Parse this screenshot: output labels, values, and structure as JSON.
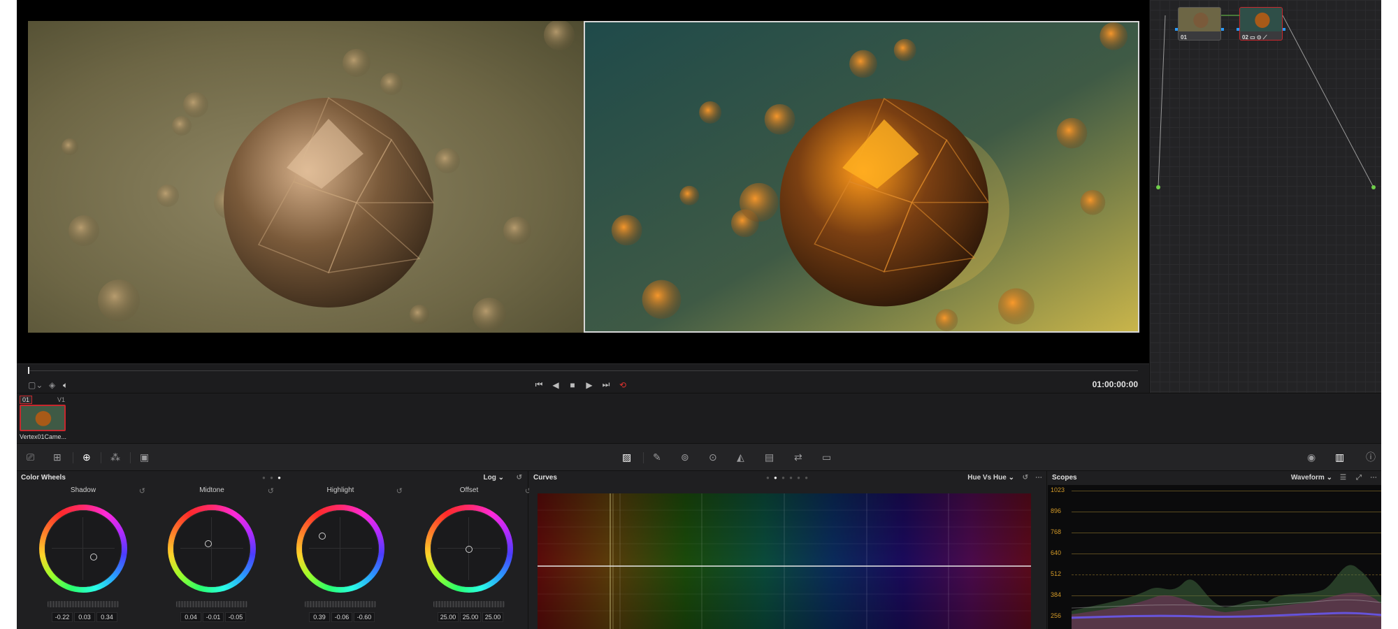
{
  "viewer": {
    "timecode": "01:00:00:00"
  },
  "nodes": [
    {
      "label": "01"
    },
    {
      "label": "02",
      "icons": "▭ ⊙ ⟋"
    }
  ],
  "clips": {
    "number": "01",
    "track": "V1",
    "name": "Vertex01Came..."
  },
  "wheels": {
    "title": "Color Wheels",
    "mode": "Log",
    "items": [
      {
        "name": "Shadow",
        "values": [
          "-0.22",
          "0.03",
          "0.34"
        ]
      },
      {
        "name": "Midtone",
        "values": [
          "0.04",
          "-0.01",
          "-0.05"
        ]
      },
      {
        "name": "Highlight",
        "values": [
          "0.39",
          "-0.06",
          "-0.60"
        ]
      },
      {
        "name": "Offset",
        "values": [
          "25.00",
          "25.00",
          "25.00"
        ]
      }
    ]
  },
  "curves": {
    "title": "Curves",
    "mode": "Hue Vs Hue"
  },
  "scopes": {
    "title": "Scopes",
    "mode": "Waveform",
    "ticks": [
      "1023",
      "896",
      "768",
      "640",
      "512",
      "384",
      "256"
    ]
  },
  "colors": {
    "accent_red": "#c8272d",
    "scope_tick": "#d39a28"
  }
}
